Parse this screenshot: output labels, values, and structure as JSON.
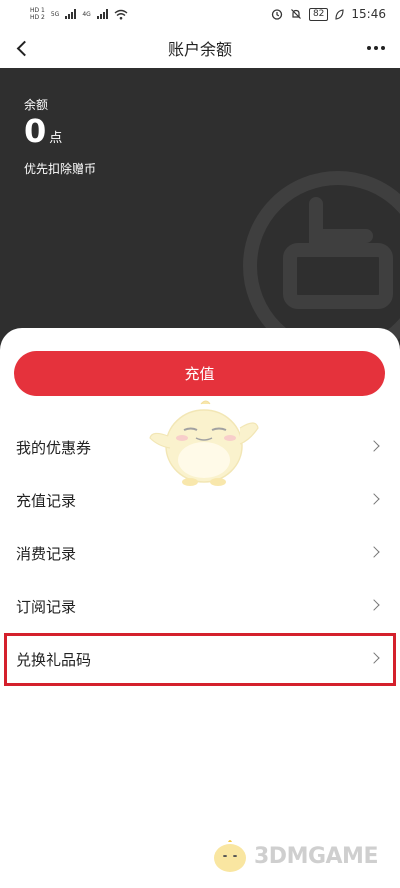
{
  "status_bar": {
    "sim1": "HD 1",
    "sim2": "HD 2",
    "net1": "5G",
    "net2": "4G",
    "battery": "82",
    "time": "15:46"
  },
  "nav": {
    "title": "账户余额"
  },
  "balance": {
    "label": "余额",
    "amount": "0",
    "unit": "点",
    "note": "优先扣除赠币"
  },
  "actions": {
    "recharge_label": "充值"
  },
  "menu": {
    "items": [
      {
        "label": "我的优惠券"
      },
      {
        "label": "充值记录"
      },
      {
        "label": "消费记录"
      },
      {
        "label": "订阅记录"
      },
      {
        "label": "兑换礼品码"
      }
    ]
  },
  "footer": {
    "brand": "3DMGAME"
  },
  "colors": {
    "accent": "#e5323c",
    "panel": "#2f2f2f",
    "highlight": "#d4202c"
  }
}
